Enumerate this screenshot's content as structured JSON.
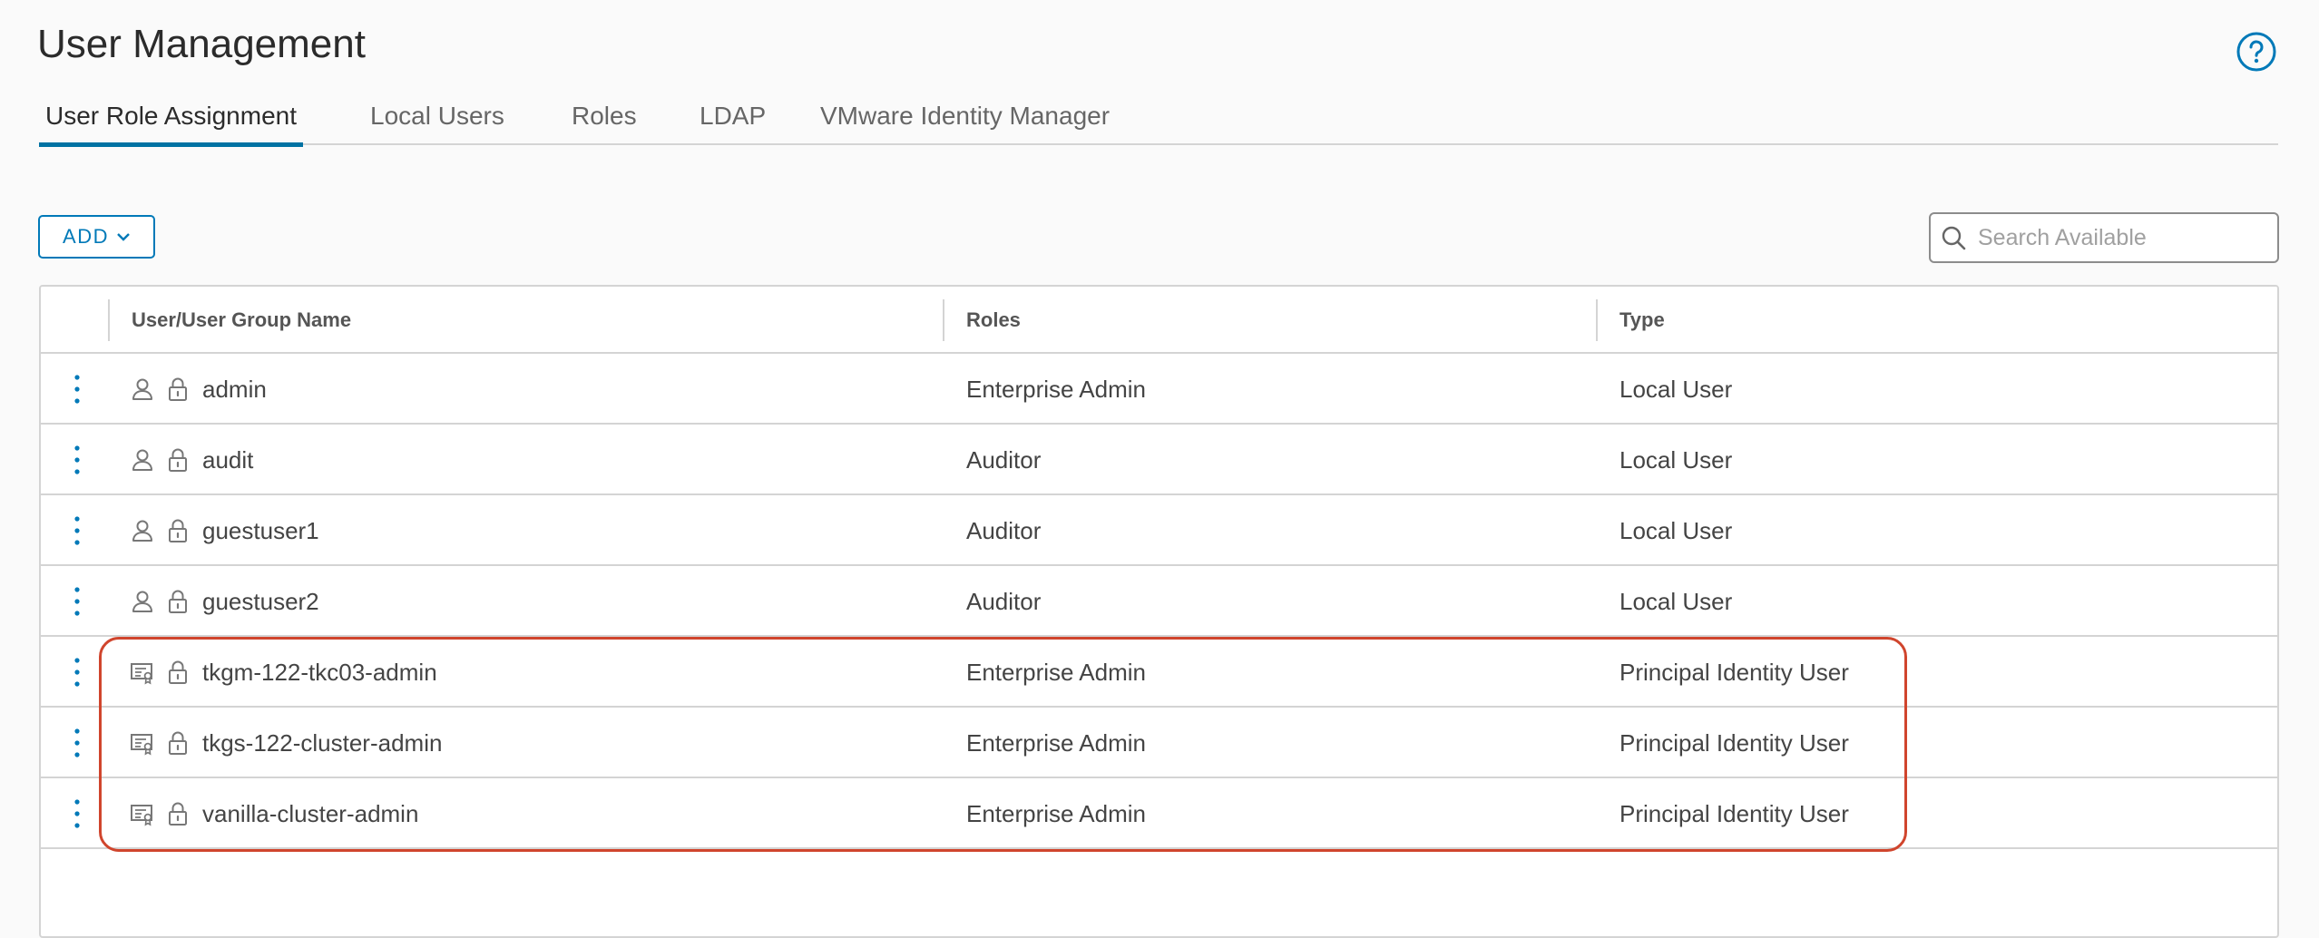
{
  "page": {
    "title": "User Management"
  },
  "tabs": [
    {
      "label": "User Role Assignment",
      "active": true
    },
    {
      "label": "Local Users",
      "active": false
    },
    {
      "label": "Roles",
      "active": false
    },
    {
      "label": "LDAP",
      "active": false
    },
    {
      "label": "VMware Identity Manager",
      "active": false
    }
  ],
  "toolbar": {
    "add_label": "ADD",
    "search_placeholder": "Search Available"
  },
  "table": {
    "columns": [
      "User/User Group Name",
      "Roles",
      "Type"
    ],
    "rows": [
      {
        "name": "admin",
        "role": "Enterprise Admin",
        "type": "Local User",
        "icon": "user-icon"
      },
      {
        "name": "audit",
        "role": "Auditor",
        "type": "Local User",
        "icon": "user-icon"
      },
      {
        "name": "guestuser1",
        "role": "Auditor",
        "type": "Local User",
        "icon": "user-icon"
      },
      {
        "name": "guestuser2",
        "role": "Auditor",
        "type": "Local User",
        "icon": "user-icon"
      },
      {
        "name": "tkgm-122-tkc03-admin",
        "role": "Enterprise Admin",
        "type": "Principal Identity User",
        "icon": "certificate-icon"
      },
      {
        "name": "tkgs-122-cluster-admin",
        "role": "Enterprise Admin",
        "type": "Principal Identity User",
        "icon": "certificate-icon"
      },
      {
        "name": "vanilla-cluster-admin",
        "role": "Enterprise Admin",
        "type": "Principal Identity User",
        "icon": "certificate-icon"
      }
    ]
  },
  "colors": {
    "accent": "#0079b8",
    "highlight": "#d0452d",
    "border": "#d4d4d4"
  }
}
